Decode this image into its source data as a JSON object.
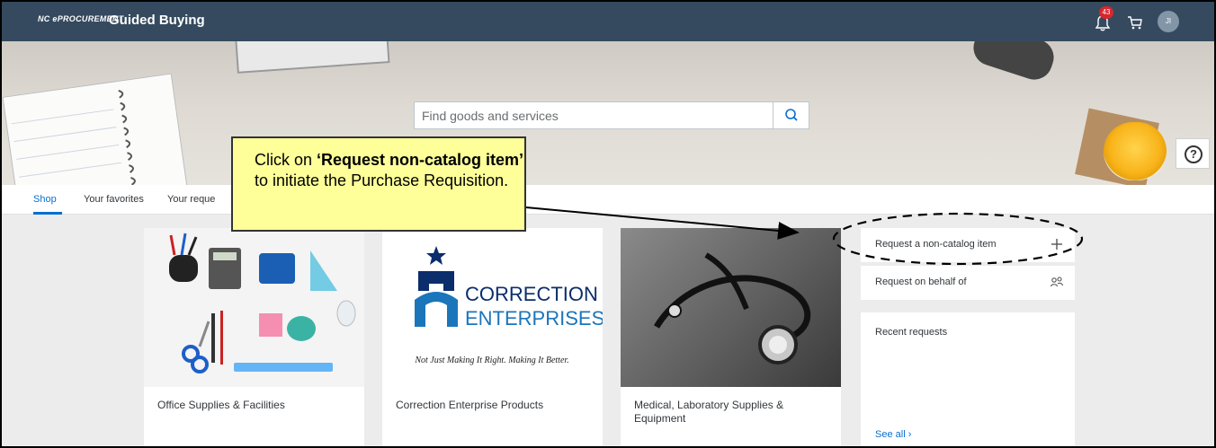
{
  "header": {
    "brand": "NC ePROCUREMENT",
    "app_title": "Guided Buying",
    "notification_count": "43",
    "avatar_initials": "JI",
    "icons": [
      "bell-icon",
      "cart-icon",
      "user-avatar"
    ]
  },
  "search": {
    "placeholder": "Find goods and services",
    "icon": "search-icon"
  },
  "tabs": [
    {
      "label": "Shop",
      "active": true
    },
    {
      "label": "Your favorites",
      "active": false
    },
    {
      "label": "Your reque",
      "active": false
    }
  ],
  "cards": [
    {
      "label": "Office Supplies & Facilities"
    },
    {
      "label": "Correction Enterprise Products",
      "logo_line1": "CORRECTION",
      "logo_line2": "ENTERPRISES",
      "tagline": "Not Just Making It Right. Making It Better."
    },
    {
      "label": "Medical, Laboratory Supplies & Equipment"
    }
  ],
  "side_panel": {
    "request_non_catalog": "Request a non-catalog item",
    "request_on_behalf": "Request on behalf of",
    "recent_requests": "Recent requests",
    "see_all": "See all"
  },
  "callout": {
    "line_a": "Click on ",
    "line_bold": "‘Request non-catalog item’",
    "line_b": " to initiate the Purchase Requisition."
  },
  "help": {
    "label": "?"
  },
  "colors": {
    "header_bg": "#354a5f",
    "accent": "#0a6ed1",
    "callout_bg": "#ffff99",
    "badge": "#d8262e"
  }
}
